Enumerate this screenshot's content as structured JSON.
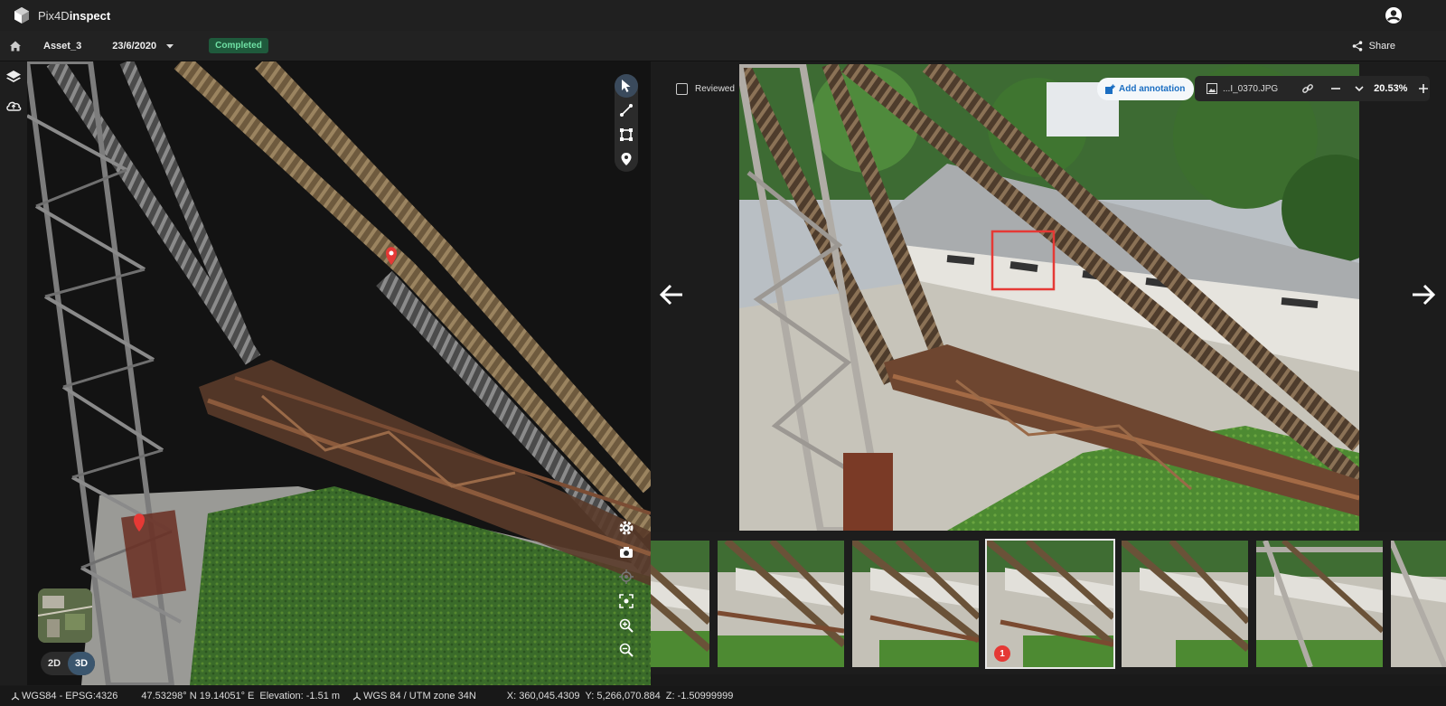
{
  "app": {
    "logo_text_light": "Pix4D",
    "logo_text_bold": "inspect"
  },
  "subbar": {
    "asset": "Asset_3",
    "date": "23/6/2020",
    "status": "Completed",
    "share_label": "Share"
  },
  "viewer3d": {
    "mode_2d": "2D",
    "mode_3d": "3D",
    "active_mode": "3D"
  },
  "photo_viewer": {
    "reviewed_label": "Reviewed",
    "add_annotation_label": "Add annotation",
    "file_name": "...I_0370.JPG",
    "zoom_level": "20.53%"
  },
  "thumbnails": [
    {
      "id": "t1",
      "annotations": ""
    },
    {
      "id": "t2",
      "annotations": ""
    },
    {
      "id": "t3",
      "annotations": ""
    },
    {
      "id": "t4",
      "annotations": "1",
      "selected": true
    },
    {
      "id": "t5",
      "annotations": ""
    },
    {
      "id": "t6",
      "annotations": ""
    },
    {
      "id": "t7",
      "annotations": ""
    }
  ],
  "statusbar": {
    "crs_geo": "WGS84 - EPSG:4326",
    "lat_lon": "47.53298° N 19.14051° E",
    "elevation": "Elevation: -1.51 m",
    "crs_proj": "WGS 84 / UTM zone 34N",
    "x": "X: 360,045.4309",
    "y": "Y: 5,266,070.884",
    "z": "Z: -1.50999999"
  },
  "colors": {
    "accent": "#1b6ec2",
    "status_green_bg": "#1f5a3c",
    "status_green_fg": "#6fe0a4",
    "marker_red": "#e53935",
    "annotation_box": "#e53935"
  }
}
